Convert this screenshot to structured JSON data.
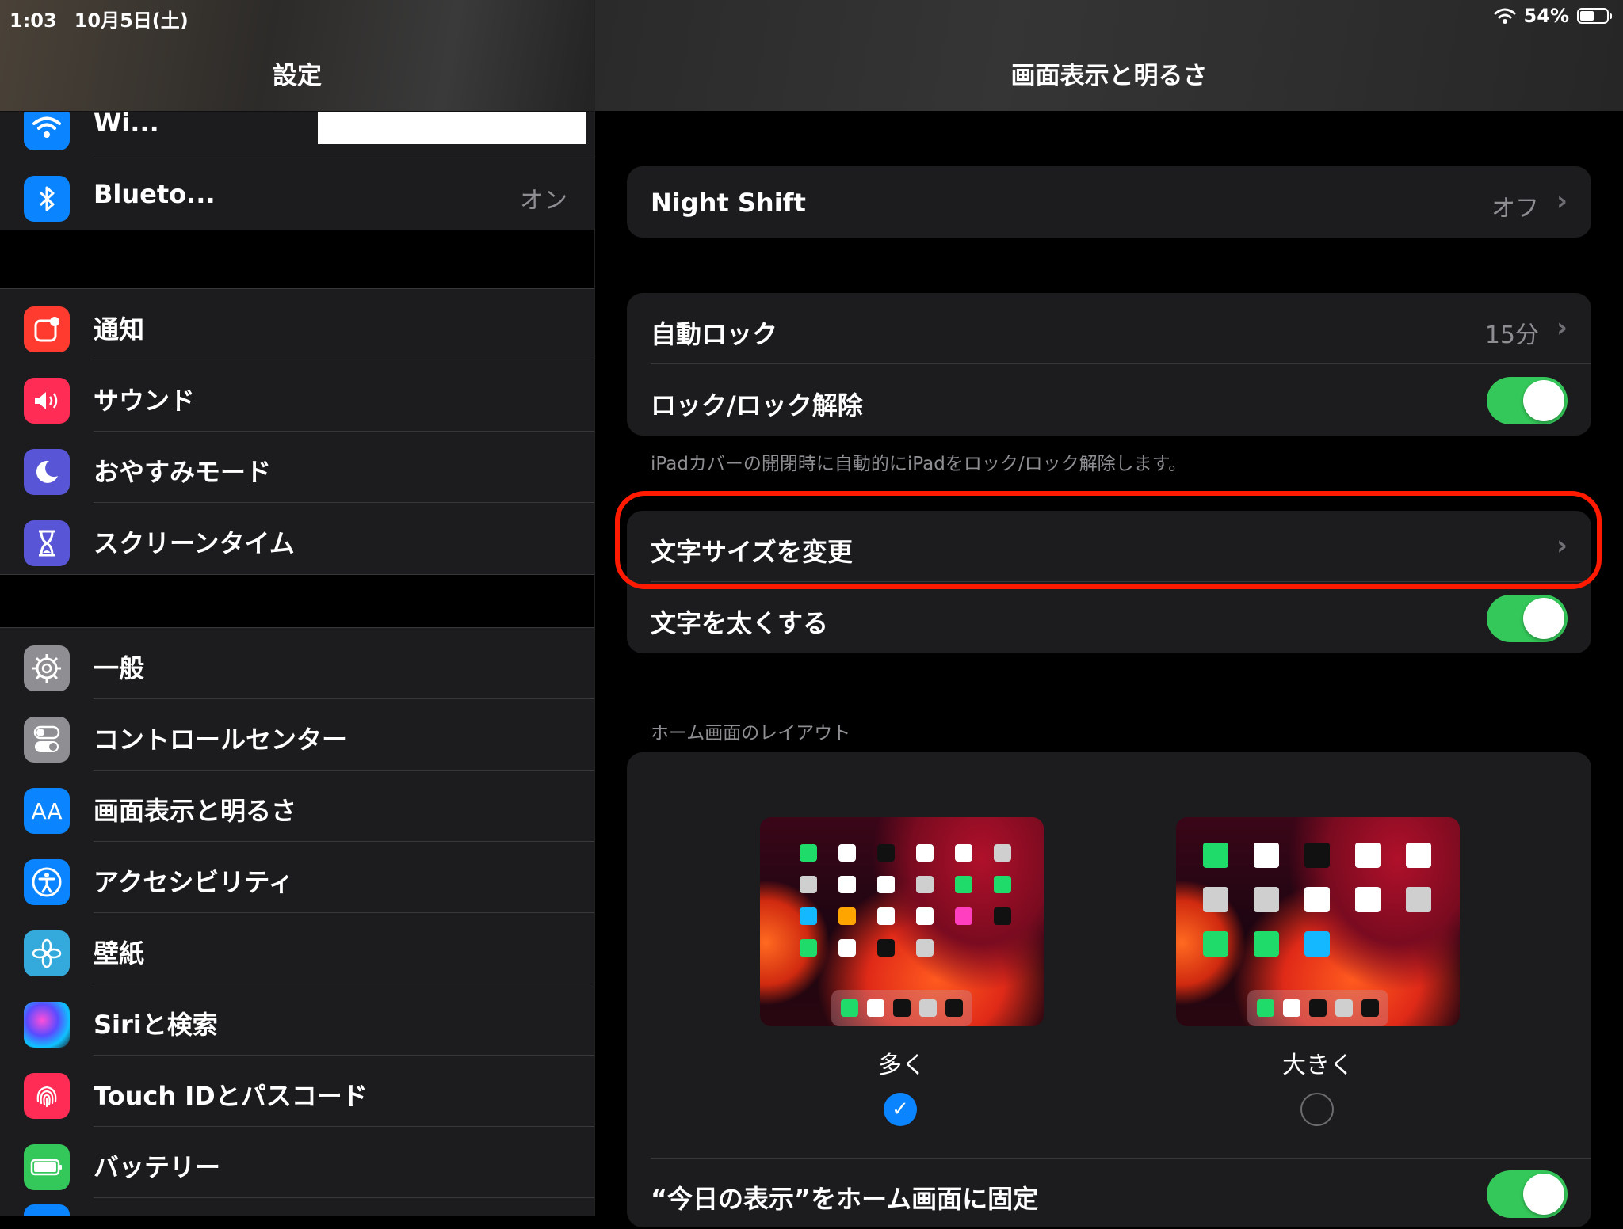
{
  "status_bar": {
    "time": "1:03",
    "date": "10月5日(土)",
    "battery_percent": "54%",
    "battery_level": 0.54
  },
  "sidebar": {
    "title": "設定",
    "group1": [
      {
        "label": "Wi...",
        "value": "",
        "icon": "wifi-icon",
        "color": "#0a84ff"
      },
      {
        "label": "Blueto...",
        "value": "オン",
        "icon": "bluetooth-icon",
        "color": "#0a84ff"
      }
    ],
    "group2": [
      {
        "label": "通知",
        "icon": "notifications-icon",
        "color": "#ff3b30"
      },
      {
        "label": "サウンド",
        "icon": "sound-icon",
        "color": "#ff2d55"
      },
      {
        "label": "おやすみモード",
        "icon": "moon-icon",
        "color": "#5856d6"
      },
      {
        "label": "スクリーンタイム",
        "icon": "hourglass-icon",
        "color": "#5856d6"
      }
    ],
    "group3": [
      {
        "label": "一般",
        "icon": "gear-icon",
        "color": "#8e8e93"
      },
      {
        "label": "コントロールセンター",
        "icon": "control-center-icon",
        "color": "#8e8e93"
      },
      {
        "label": "画面表示と明るさ",
        "icon": "display-icon",
        "color": "#0a84ff"
      },
      {
        "label": "アクセシビリティ",
        "icon": "accessibility-icon",
        "color": "#0a84ff"
      },
      {
        "label": "壁紙",
        "icon": "wallpaper-icon",
        "color": "#34aadc"
      },
      {
        "label": "Siriと検索",
        "icon": "siri-icon",
        "color": "#2c2c2e"
      },
      {
        "label": "Touch IDとパスコード",
        "icon": "fingerprint-icon",
        "color": "#ff2d55"
      },
      {
        "label": "バッテリー",
        "icon": "battery-icon",
        "color": "#34c759"
      }
    ]
  },
  "main": {
    "title": "画面表示と明るさ",
    "night_shift": {
      "label": "Night Shift",
      "value": "オフ"
    },
    "auto_lock": {
      "label": "自動ロック",
      "value": "15分"
    },
    "lock_unlock": {
      "label": "ロック/ロック解除",
      "on": true
    },
    "lock_footnote": "iPadカバーの開閉時に自動的にiPadをロック/ロック解除します。",
    "text_size": {
      "label": "文字サイズを変更"
    },
    "bold_text": {
      "label": "文字を太くする",
      "on": true
    },
    "home_layout_header": "ホーム画面のレイアウト",
    "layout_more": "多く",
    "layout_bigger": "大きく",
    "layout_selected": "多く",
    "pin_today": {
      "label": "“今日の表示”をホーム画面に固定",
      "on": true
    }
  },
  "colors": {
    "accent": "#0a84ff",
    "toggle_on": "#34c759",
    "highlight": "#ff1a00"
  }
}
